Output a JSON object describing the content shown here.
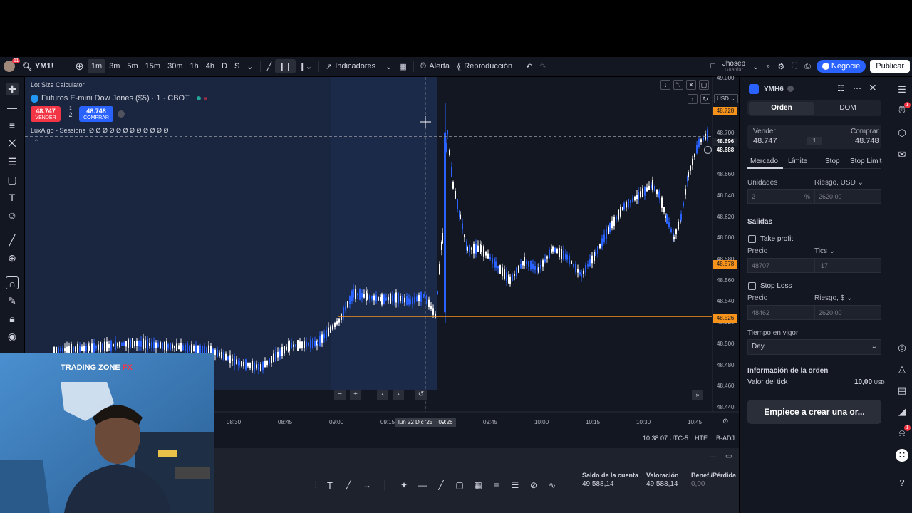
{
  "topbar": {
    "symbol": "YM1!",
    "notif_count": "11",
    "timeframes": [
      "1m",
      "3m",
      "5m",
      "15m",
      "30m",
      "1h",
      "4h",
      "D",
      "S"
    ],
    "indicators_label": "Indicadores",
    "alert_label": "Alerta",
    "replay_label": "Reproducción",
    "user_name": "Jhosep",
    "user_sub": "Guardar",
    "negocie_label": "Negocie",
    "publish_label": "Publicar"
  },
  "chart": {
    "script_label": "Lot Size Calculator",
    "title": "Futuros E-mini Dow Jones ($5) · 1 · CBOT",
    "sell_price": "48.747",
    "sell_label": "VENDER",
    "buy_price": "48.748",
    "buy_label": "COMPRAR",
    "spread_top": "1",
    "spread_qty": "2",
    "luxalgo_label": "LuxAlgo - Sessions",
    "luxalgo_values": "Ø Ø Ø Ø Ø Ø Ø Ø Ø Ø Ø Ø",
    "currency": "USD",
    "price_axis": [
      "49.000",
      "48.720",
      "48.700",
      "48.680",
      "48.660",
      "48.640",
      "48.620",
      "48.600",
      "48.580",
      "48.560",
      "48.540",
      "48.520",
      "48.500",
      "48.480",
      "48.460",
      "48.440"
    ],
    "price_tags": {
      "top_orange": "48.728",
      "crosshair": "48.696",
      "current": "48.688",
      "mid_orange": "48.578",
      "low_orange": "48.526"
    },
    "time_axis": [
      "08:30",
      "08:45",
      "09:00",
      "09:15",
      "09:26",
      "09:45",
      "10:00",
      "10:15",
      "10:30",
      "10:45"
    ],
    "crosshair_time": "lun 22 Dic '25",
    "status_time": "10:38:07 UTC-5",
    "status_hte": "HTE",
    "status_badj": "B-ADJ",
    "colors": {
      "up": "#2962ff",
      "down": "#ffffff",
      "bg": "#131722",
      "session": "#1a2540",
      "orange": "#f7931a"
    }
  },
  "panel": {
    "symbol": "YMH6",
    "tab_order": "Orden",
    "tab_dom": "DOM",
    "sell_label": "Vender",
    "sell_price": "48.747",
    "buy_label": "Comprar",
    "buy_price": "48.748",
    "spread": "1",
    "order_types": [
      "Mercado",
      "Límite",
      "Stop",
      "Stop Limit"
    ],
    "units_label": "Unidades",
    "risk_label": "Riesgo, USD",
    "units_value": "2",
    "units_pct": "%",
    "risk_value": "2620.00",
    "exits_label": "Salidas",
    "take_profit_label": "Take profit",
    "tp_price_label": "Precio",
    "tp_ticks_label": "Tics",
    "tp_price": "48707",
    "tp_ticks": "-17",
    "stop_loss_label": "Stop Loss",
    "sl_price_label": "Precio",
    "sl_risk_label": "Riesgo, $",
    "sl_price": "48462",
    "sl_risk": "2620.00",
    "tif_label": "Tiempo en vigor",
    "tif_value": "Day",
    "info_title": "Información de la orden",
    "tick_value_label": "Valor del tick",
    "tick_value": "10,00",
    "tick_value_currency": "USD",
    "cta_label": "Empiece a crear una or..."
  },
  "bottom": {
    "balance_label": "Saldo de la cuenta",
    "balance_value": "49.588,14",
    "valuation_label": "Valoración",
    "valuation_value": "49.588,14",
    "pnl_label": "Benef./Pérdida",
    "pnl_value": "0,00"
  },
  "webcam": {
    "brand": "TRADING ZONE",
    "brand_suffix": "FX"
  }
}
